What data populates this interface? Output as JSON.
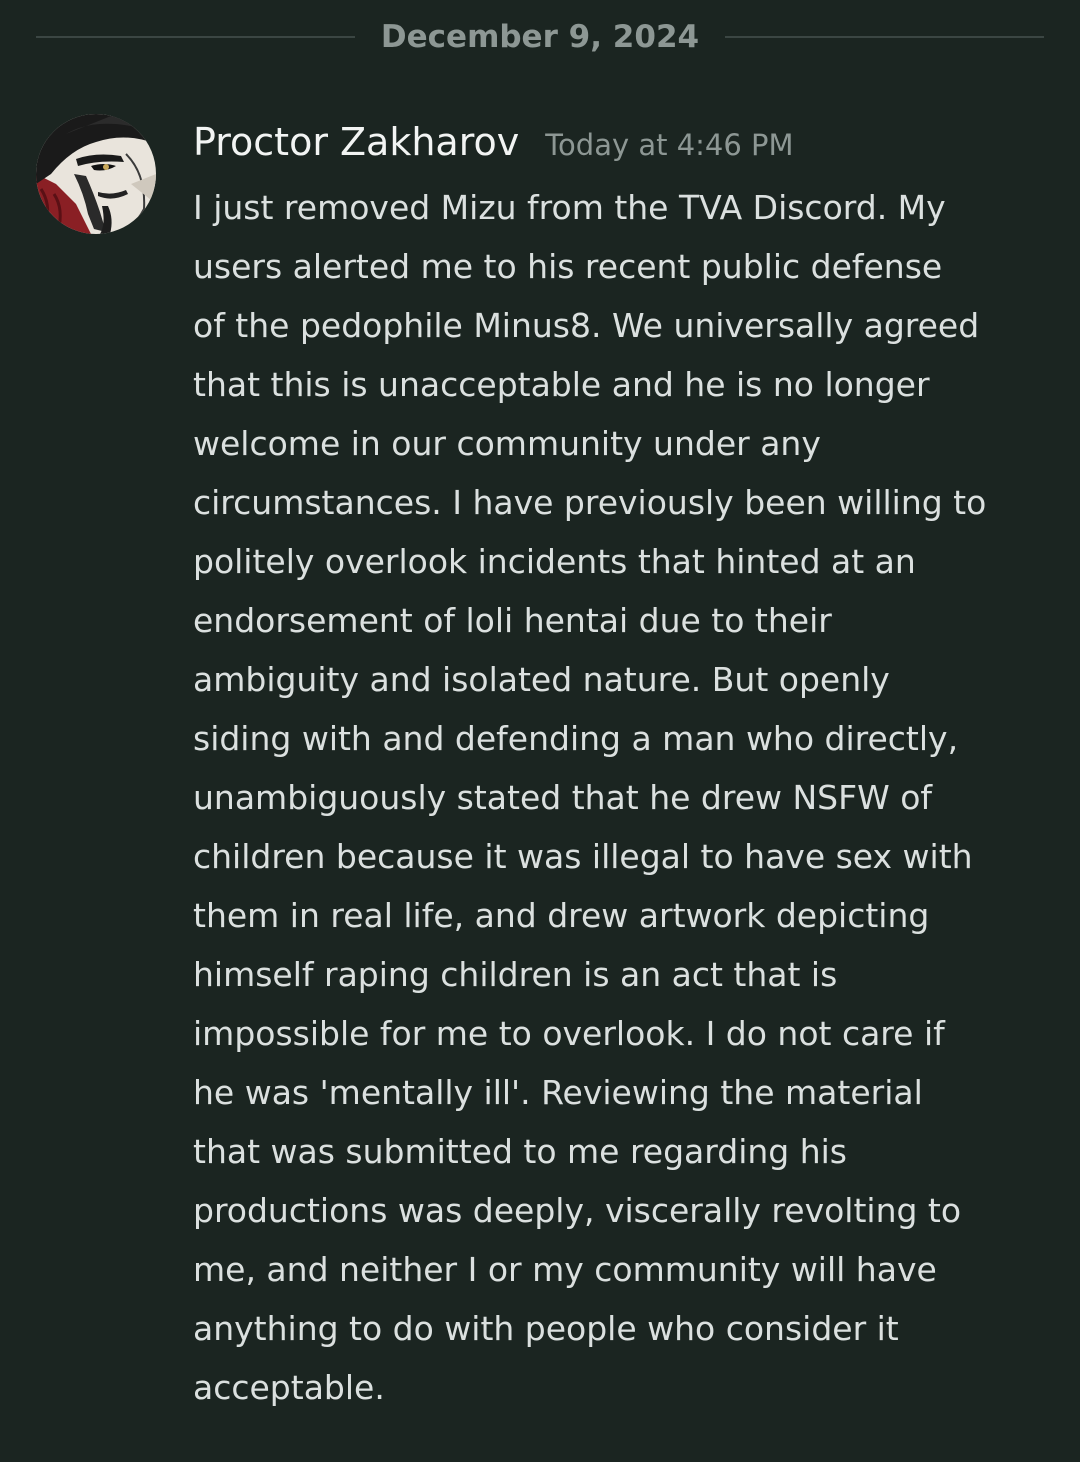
{
  "date_divider": "December 9, 2024",
  "message": {
    "author": "Proctor Zakharov",
    "timestamp": "Today at 4:46 PM",
    "avatar_icon": "anime-character-avatar",
    "lines": [
      "I just removed Mizu from the TVA Discord. My",
      "users alerted me to his recent public defense",
      "of the pedophile Minus8. We universally agreed",
      "that this is unacceptable and he is no longer",
      "welcome in our community under any",
      "circumstances. I have previously been willing to",
      "politely overlook incidents that hinted at an",
      "endorsement of loli hentai due to their",
      "ambiguity and isolated nature. But openly",
      "siding with and defending a man who directly,",
      "unambiguously stated that he drew NSFW of",
      "children because it was illegal to have sex with",
      "them in real life, and drew artwork depicting",
      "himself raping children is an act that is",
      "impossible for me to overlook. I do not care if",
      "he was 'mentally ill'. Reviewing the material",
      "that was submitted to me regarding his",
      "productions was deeply, viscerally revolting to",
      "me, and neither I or my community will have",
      "anything to do with people who consider it",
      "acceptable."
    ]
  }
}
